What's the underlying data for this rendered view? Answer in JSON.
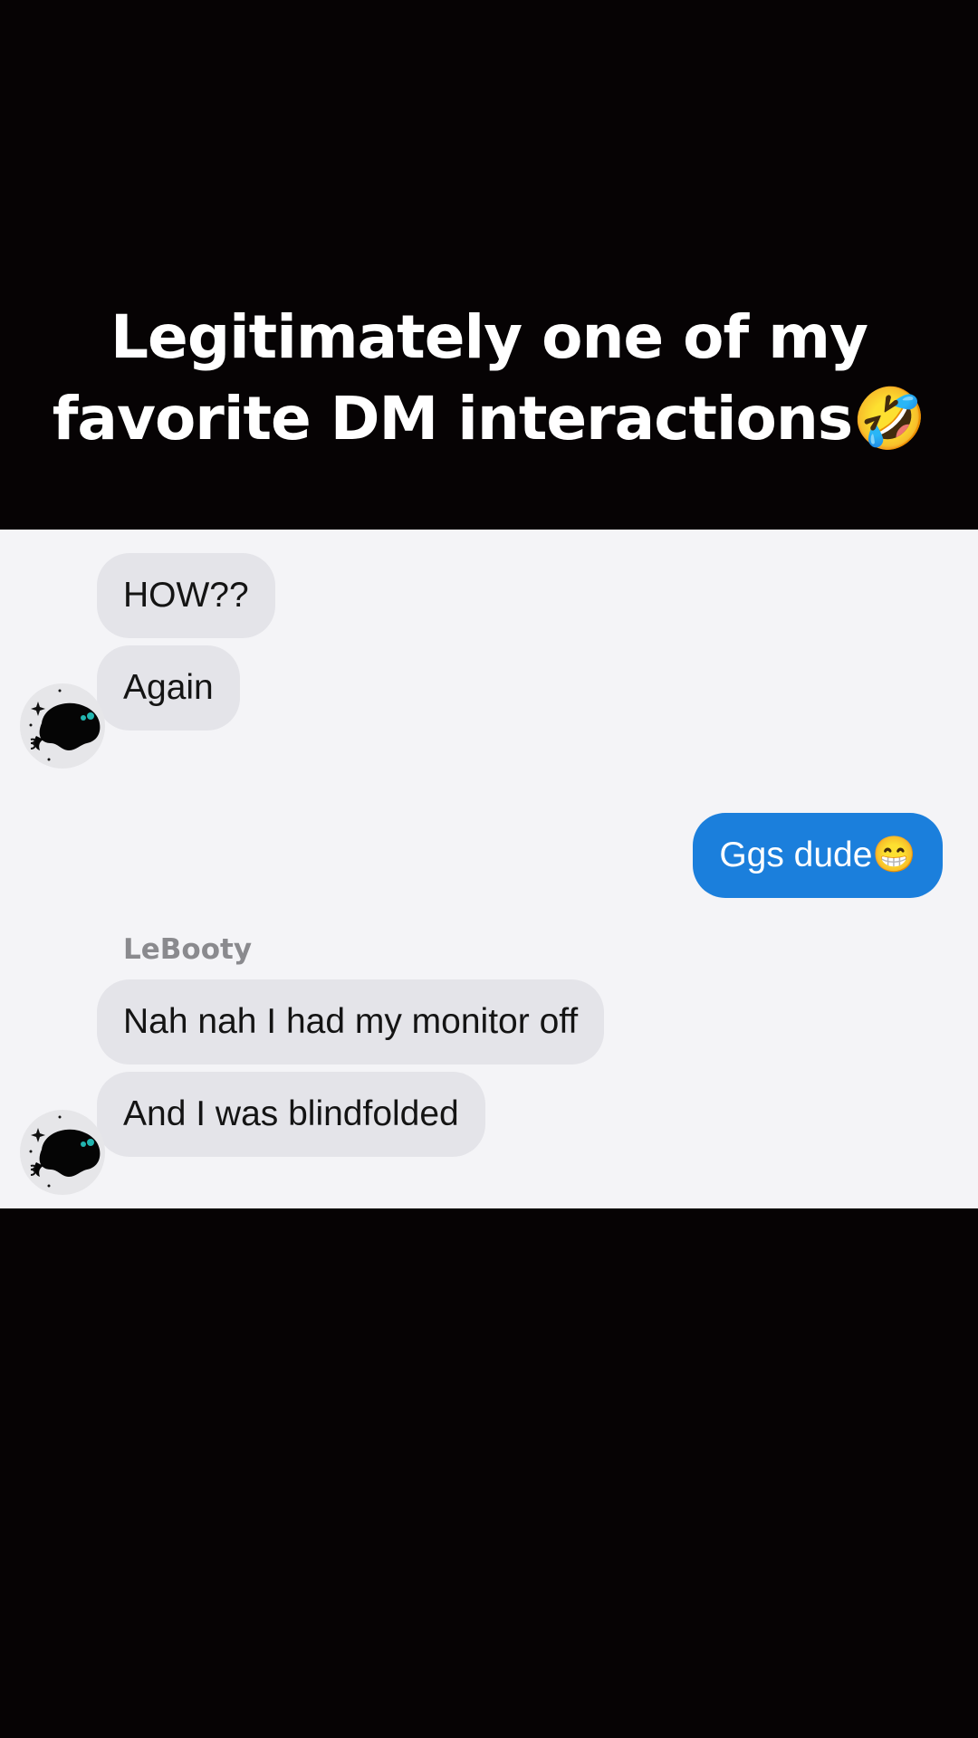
{
  "caption": {
    "line1": "Legitimately one of my",
    "line2": "favorite DM interactions🤣"
  },
  "chat": {
    "sender_name": "LeBooty",
    "messages": [
      {
        "from": "them",
        "text": "HOW??"
      },
      {
        "from": "them",
        "text": "Again"
      },
      {
        "from": "me",
        "text": "Ggs dude😁"
      },
      {
        "from": "them",
        "text": "Nah nah I had my monitor off"
      },
      {
        "from": "them",
        "text": "And I was blindfolded"
      }
    ]
  },
  "colors": {
    "background": "#060304",
    "chat_background": "#f4f4f7",
    "incoming_bubble": "#e4e4e9",
    "outgoing_bubble": "#1b7fdc",
    "sender_name": "#8a8a8e"
  },
  "icons": {
    "avatar": "ghost-creature-avatar-icon"
  }
}
